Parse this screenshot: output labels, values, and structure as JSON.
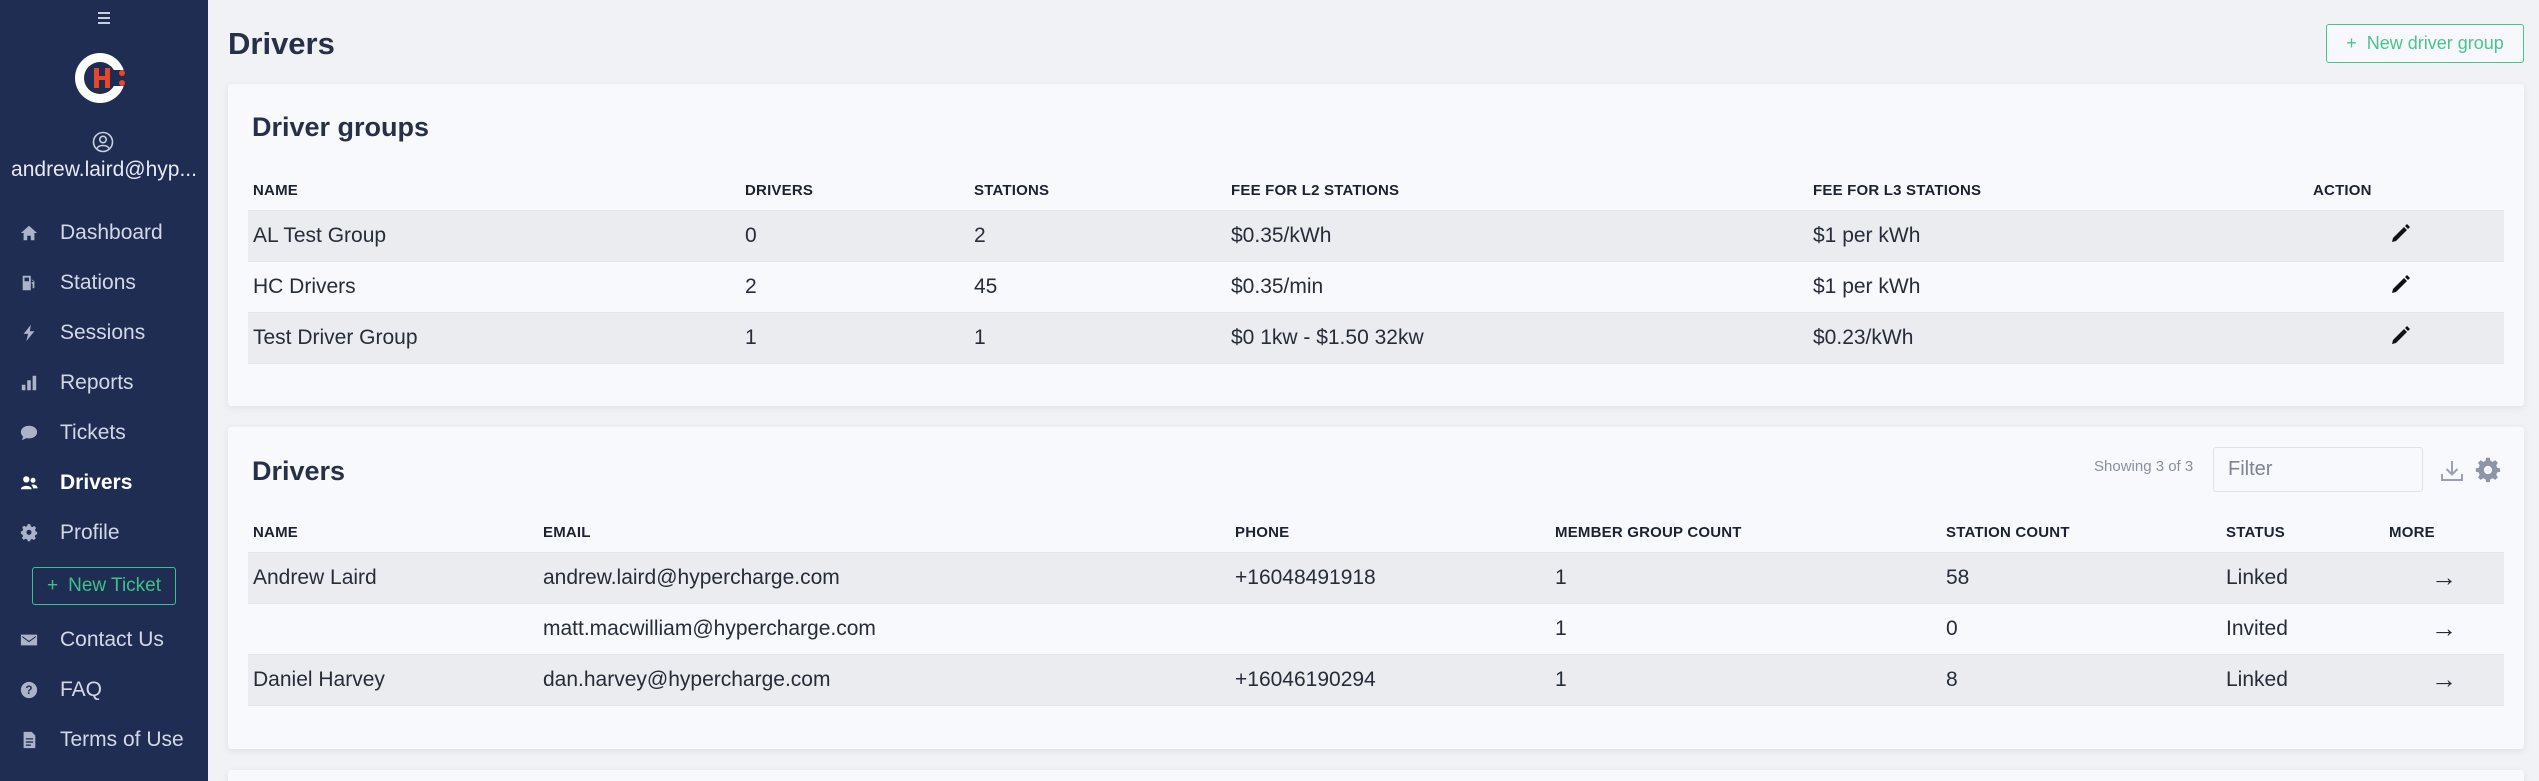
{
  "sidebar": {
    "user_email": "andrew.laird@hyp...",
    "items": [
      {
        "label": "Dashboard",
        "icon": "home-icon"
      },
      {
        "label": "Stations",
        "icon": "gas-pump-icon"
      },
      {
        "label": "Sessions",
        "icon": "bolt-icon"
      },
      {
        "label": "Reports",
        "icon": "chart-bar-icon"
      },
      {
        "label": "Tickets",
        "icon": "comment-icon"
      },
      {
        "label": "Drivers",
        "icon": "users-icon",
        "active": true
      },
      {
        "label": "Profile",
        "icon": "gear-icon"
      }
    ],
    "new_ticket_label": "New Ticket",
    "bottom_items": [
      {
        "label": "Contact Us",
        "icon": "envelope-icon"
      },
      {
        "label": "FAQ",
        "icon": "question-circle-icon"
      },
      {
        "label": "Terms of Use",
        "icon": "document-icon"
      }
    ]
  },
  "header": {
    "title": "Drivers",
    "new_group_label": "New driver group"
  },
  "groups": {
    "title": "Driver groups",
    "columns": [
      "NAME",
      "DRIVERS",
      "STATIONS",
      "FEE FOR L2 STATIONS",
      "FEE FOR L3 STATIONS",
      "ACTION"
    ],
    "rows": [
      {
        "name": "AL Test Group",
        "drivers": "0",
        "stations": "2",
        "fee_l2": "$0.35/kWh",
        "fee_l3": "$1 per kWh"
      },
      {
        "name": "HC Drivers",
        "drivers": "2",
        "stations": "45",
        "fee_l2": "$0.35/min",
        "fee_l3": "$1 per kWh"
      },
      {
        "name": "Test Driver Group",
        "drivers": "1",
        "stations": "1",
        "fee_l2": "$0 1kw - $1.50 32kw",
        "fee_l3": "$0.23/kWh"
      }
    ]
  },
  "drivers": {
    "title": "Drivers",
    "showing": "Showing 3 of 3",
    "filter_placeholder": "Filter",
    "columns": [
      "NAME",
      "EMAIL",
      "PHONE",
      "MEMBER GROUP COUNT",
      "STATION COUNT",
      "STATUS",
      "MORE"
    ],
    "rows": [
      {
        "name": "Andrew Laird",
        "email": "andrew.laird@hypercharge.com",
        "phone": "+16048491918",
        "groups": "1",
        "stations": "58",
        "status": "Linked",
        "more": "→"
      },
      {
        "name": "",
        "email": "matt.macwilliam@hypercharge.com",
        "phone": "",
        "groups": "1",
        "stations": "0",
        "status": "Invited",
        "more": "→"
      },
      {
        "name": "Daniel Harvey",
        "email": "dan.harvey@hypercharge.com",
        "phone": "+16046190294",
        "groups": "1",
        "stations": "8",
        "status": "Linked",
        "more": "→"
      }
    ]
  },
  "colors": {
    "sidebar_bg": "#1f2d52",
    "accent_green": "#49c48f",
    "logo_red": "#e8452c"
  }
}
